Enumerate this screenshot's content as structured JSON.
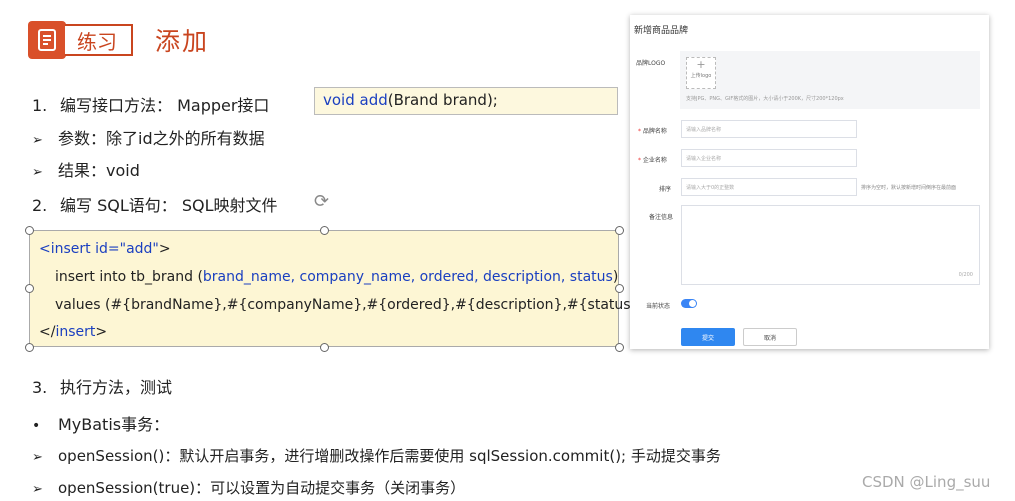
{
  "header": {
    "box_label": "练习",
    "title": "添加"
  },
  "steps": {
    "s1_num": "1.",
    "s1_text": "编写接口方法： Mapper接口",
    "p1": "参数：除了id之外的所有数据",
    "p2": "结果：void",
    "s2_num": "2.",
    "s2_text": "编写 SQL语句： SQL映射文件",
    "s3_num": "3.",
    "s3_text": "执行方法，测试",
    "mb_title": "MyBatis事务：",
    "mb1": "openSession()：默认开启事务，进行增删改操作后需要使用 sqlSession.commit(); 手动提交事务",
    "mb2": "openSession(true)：可以设置为自动提交事务（关闭事务）"
  },
  "symbols": {
    "arrow": "➢",
    "bullet": "•",
    "rotate": "⟳"
  },
  "code1": {
    "kw": "void add",
    "rest": "(Brand brand);"
  },
  "code2": {
    "l1_open": "<",
    "l1_tag": "insert",
    "l1_attr": " id=",
    "l1_val": "\"add\"",
    "l1_close": ">",
    "l2_a": "insert into tb_brand (",
    "l2_cols": "brand_name, company_name, ordered, description, status",
    "l2_b": ")",
    "l3": "values (#{brandName},#{companyName},#{ordered},#{description},#{status});",
    "l4_open": "</",
    "l4_tag": "insert",
    "l4_close": ">"
  },
  "form": {
    "title": "新增商品品牌",
    "logo_label": "品牌LOGO",
    "upload_plus": "+",
    "upload_text": "上传logo",
    "upload_hint": "支持JPG、PNG、GIF格式的图片，大小请小于200K，尺寸200*120px",
    "required_mark": "*",
    "brand_label": "品牌名称",
    "brand_placeholder": "请输入品牌名称",
    "company_label": "企业名称",
    "company_placeholder": "请输入企业名称",
    "order_label": "排序",
    "order_placeholder": "请输入大于0的正整数",
    "order_hint": "排序为空时，默认按新增时间倒序在最前面",
    "remark_label": "备注信息",
    "remark_counter": "0/200",
    "status_label": "当前状态",
    "submit": "提交",
    "cancel": "取消"
  },
  "colors": {
    "accent": "#c9451f",
    "keyword": "#1a3fc0",
    "code_bg": "#fdf6d4",
    "primary": "#2f87f0"
  },
  "watermark": "CSDN @Ling_suu"
}
